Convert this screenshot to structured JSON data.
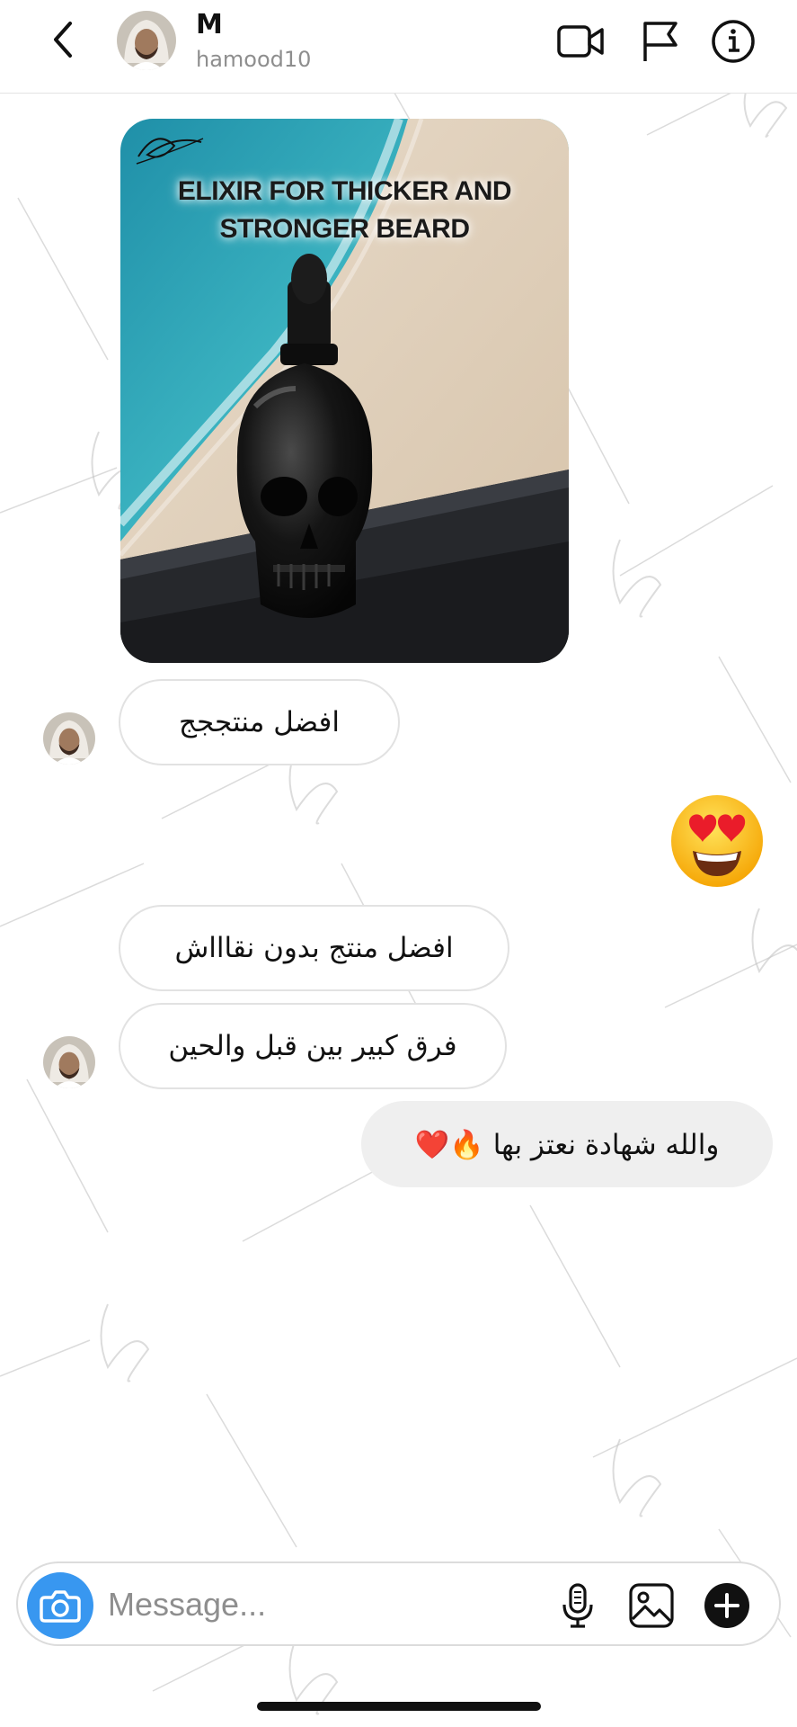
{
  "header": {
    "name": "M",
    "username": "hamood10",
    "icons": [
      "back-chevron-icon",
      "video-call-icon",
      "flag-icon",
      "info-icon"
    ]
  },
  "shared_post": {
    "title_line1": "ELIXIR FOR THICKER AND",
    "title_line2": "STRONGER BEARD",
    "signature": "Baxhamis"
  },
  "messages": [
    {
      "side": "received",
      "text": "افضل منتججج"
    },
    {
      "side": "sent",
      "emoji": "heart-eyes-emoji"
    },
    {
      "side": "received",
      "text": "افضل منتج بدون نقاااش"
    },
    {
      "side": "received",
      "text": "فرق كبير بين قبل والحين"
    },
    {
      "side": "sent",
      "text": "والله شهادة نعتز بها 🔥❤️"
    }
  ],
  "composer": {
    "placeholder": "Message..."
  },
  "colors": {
    "accent_blue": "#3897f0",
    "received_border": "#e2e2e2",
    "sent_bg": "#efefef",
    "secondary_text": "#8e8e8e"
  }
}
